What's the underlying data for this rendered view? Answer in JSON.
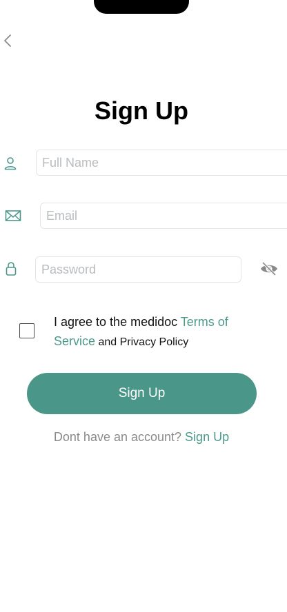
{
  "title": "Sign Up",
  "form": {
    "full_name": {
      "placeholder": "Full Name",
      "value": ""
    },
    "email": {
      "placeholder": "Email",
      "value": ""
    },
    "password": {
      "placeholder": "Password",
      "value": ""
    }
  },
  "agreement": {
    "prefix": "I agree to the medidoc ",
    "terms_link": "Terms of Service",
    "connector": " and ",
    "privacy": "Privacy Policy",
    "checked": false
  },
  "signup_button": "Sign Up",
  "footer": {
    "prompt": "Dont have an account? ",
    "link": "Sign Up"
  },
  "icons": {
    "back": "chevron-left-icon",
    "name": "user-icon",
    "email": "envelope-icon",
    "password": "lock-icon",
    "visibility": "eye-slash-icon"
  },
  "colors": {
    "accent": "#4a978a",
    "link": "#4a9a8c",
    "placeholder": "#b9bcbf"
  }
}
